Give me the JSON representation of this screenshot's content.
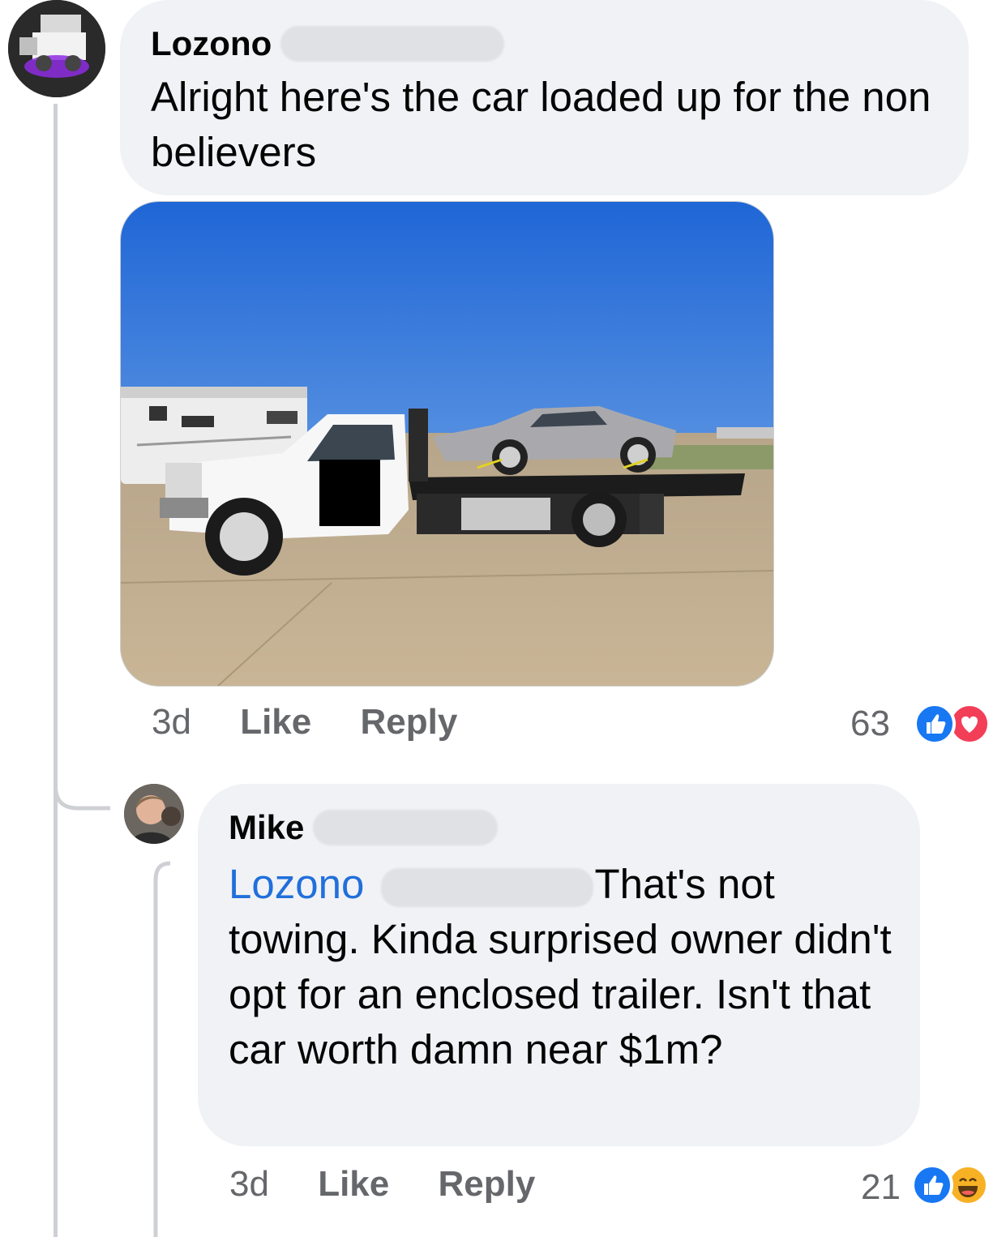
{
  "comments": [
    {
      "author": "Lozono",
      "text": "Alright here's the car loaded up for the non believers",
      "time": "3d",
      "like_label": "Like",
      "reply_label": "Reply",
      "reaction_count": "63",
      "reactions": [
        "like-icon",
        "love-icon"
      ]
    },
    {
      "author": "Mike",
      "mention": "Lozono",
      "text": "That's not towing. Kinda surprised owner didn't opt for an enclosed trailer. Isn't that car worth damn near $1m?",
      "time": "3d",
      "like_label": "Like",
      "reply_label": "Reply",
      "reaction_count": "21",
      "reactions": [
        "like-icon",
        "haha-icon"
      ]
    }
  ],
  "colors": {
    "bubble": "#f0f2f5",
    "mention": "#216fdb",
    "like_blue": "#1877f2",
    "love_red": "#f33e58",
    "haha_yellow": "#f7b125",
    "meta_gray": "#65676b"
  }
}
